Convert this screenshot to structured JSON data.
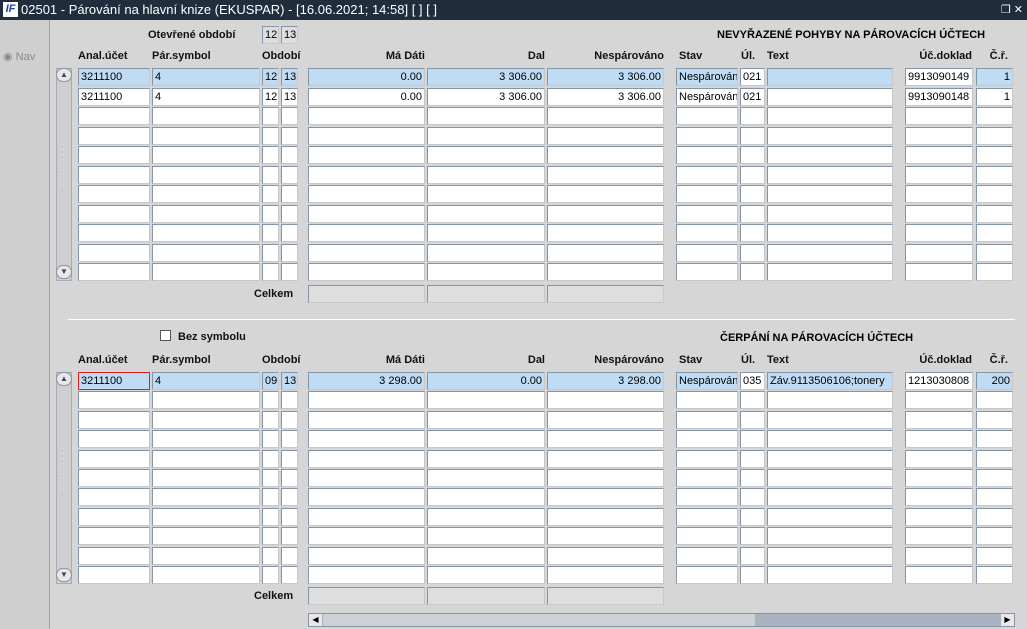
{
  "window": {
    "title": "02501 - Párování na hlavní knize (EKUSPAR) - [16.06.2021; 14:58]  [ ]  [ ]",
    "logo": "IF",
    "controls": "❐ ✕"
  },
  "nav": {
    "label": "Nav"
  },
  "top": {
    "open_period_label": "Otevřené období",
    "open_period": [
      "12",
      "13"
    ],
    "section_title": "NEVYŘAZENÉ POHYBY NA PÁROVACÍCH ÚČTECH",
    "total_label": "Celkem",
    "rows": [
      [
        "3211100",
        "4",
        "12",
        "13",
        "0.00",
        "3 306.00",
        "3 306.00",
        "Nespárován",
        "021",
        "",
        "9913090149",
        "1"
      ],
      [
        "3211100",
        "4",
        "12",
        "13",
        "0.00",
        "3 306.00",
        "3 306.00",
        "Nespárován",
        "021",
        "",
        "9913090148",
        "1"
      ]
    ]
  },
  "bottom": {
    "no_symbol_label": "Bez symbolu",
    "section_title": "ČERPÁNÍ NA PÁROVACÍCH ÚČTECH",
    "total_label": "Celkem",
    "rows": [
      [
        "3211100",
        "4",
        "09",
        "13",
        "3 298.00",
        "0.00",
        "3 298.00",
        "Nespárován",
        "035",
        "Záv.9113506106;tonery",
        "1213030808",
        "200"
      ]
    ]
  },
  "columns": [
    "Anal.účet",
    "Pár.symbol",
    "Období",
    "Má Dáti",
    "Dal",
    "Nespárováno",
    "Stav",
    "Úl.",
    "Text",
    "Úč.doklad",
    "Č.ř."
  ]
}
